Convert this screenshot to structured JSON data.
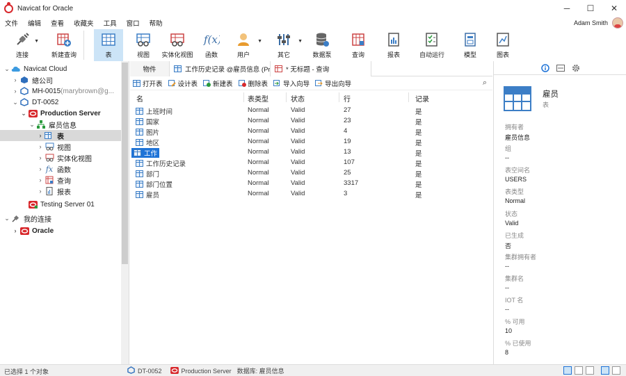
{
  "window": {
    "title": "Navicat for Oracle",
    "minimize": "─",
    "maximize": "☐",
    "close": "✕"
  },
  "menu": [
    "文件",
    "编辑",
    "查看",
    "收藏夹",
    "工具",
    "窗口",
    "帮助"
  ],
  "user": {
    "name": "Adam Smith"
  },
  "toolbar": [
    {
      "label": "连接",
      "icon": "connection-icon",
      "caret": true
    },
    {
      "label": "新建查询",
      "icon": "new-query-icon"
    },
    {
      "label": "表",
      "icon": "table-icon",
      "active": true
    },
    {
      "label": "视图",
      "icon": "view-icon"
    },
    {
      "label": "实体化视图",
      "icon": "materialized-view-icon"
    },
    {
      "label": "函数",
      "icon": "function-icon"
    },
    {
      "label": "用户",
      "icon": "user-icon",
      "caret": true
    },
    {
      "label": "其它",
      "icon": "tools-icon",
      "caret": true
    },
    {
      "label": "数据泵",
      "icon": "data-pump-icon"
    },
    {
      "label": "查询",
      "icon": "query-icon"
    },
    {
      "label": "报表",
      "icon": "report-icon"
    },
    {
      "label": "自动运行",
      "icon": "automation-icon"
    },
    {
      "label": "模型",
      "icon": "model-icon"
    },
    {
      "label": "图表",
      "icon": "chart-icon"
    }
  ],
  "tree": [
    {
      "label": "Navicat Cloud",
      "twisty": "⌄",
      "icon": "cloud-icon"
    },
    {
      "label": "總公司",
      "twisty": "›",
      "icon": "project-icon"
    },
    {
      "label": "MH-0015",
      "extra": " (marybrown@g...",
      "twisty": "›",
      "icon": "cloud-connection-icon"
    },
    {
      "label": "DT-0052",
      "twisty": "⌄",
      "icon": "cloud-connection-icon"
    },
    {
      "label": "Production Server",
      "twisty": "⌄",
      "icon": "oracle-server-icon",
      "bold": true
    },
    {
      "label": "雇员信息",
      "twisty": "⌄",
      "icon": "schema-icon"
    },
    {
      "label": "表",
      "twisty": "›",
      "icon": "table-icon",
      "bold": true,
      "selected": true
    },
    {
      "label": "视图",
      "twisty": "›",
      "icon": "view-icon"
    },
    {
      "label": "实体化视图",
      "twisty": "›",
      "icon": "materialized-view-icon"
    },
    {
      "label": "函数",
      "twisty": "›",
      "icon": "function-icon"
    },
    {
      "label": "查询",
      "twisty": "›",
      "icon": "query-icon"
    },
    {
      "label": "报表",
      "twisty": "›",
      "icon": "report-icon"
    },
    {
      "label": "Testing Server 01",
      "twisty": "",
      "icon": "oracle-server-icon"
    },
    {
      "label": "我的连接",
      "twisty": "⌄",
      "icon": "connection-icon"
    },
    {
      "label": "Oracle",
      "twisty": "›",
      "icon": "oracle-server-icon"
    }
  ],
  "tabs": {
    "objects": "物件",
    "tab1": "工作历史记录 @雇员信息 (Pr...",
    "tab2": "* 无标题 - 查询"
  },
  "objbar": [
    "打开表",
    "设计表",
    "新建表",
    "删除表",
    "导入向导",
    "导出向导"
  ],
  "columns": [
    "名",
    "表类型",
    "状态",
    "行",
    "记录"
  ],
  "rows": [
    {
      "name": "上班时间",
      "type": "Normal",
      "status": "Valid",
      "rows": "27",
      "record": "是"
    },
    {
      "name": "国家",
      "type": "Normal",
      "status": "Valid",
      "rows": "23",
      "record": "是"
    },
    {
      "name": "图片",
      "type": "Normal",
      "status": "Valid",
      "rows": "4",
      "record": "是"
    },
    {
      "name": "地区",
      "type": "Normal",
      "status": "Valid",
      "rows": "19",
      "record": "是"
    },
    {
      "name": "工作",
      "type": "Normal",
      "status": "Valid",
      "rows": "13",
      "record": "是",
      "selected": true
    },
    {
      "name": "工作历史记录",
      "type": "Normal",
      "status": "Valid",
      "rows": "107",
      "record": "是"
    },
    {
      "name": "部门",
      "type": "Normal",
      "status": "Valid",
      "rows": "25",
      "record": "是"
    },
    {
      "name": "部门位置",
      "type": "Normal",
      "status": "Valid",
      "rows": "3317",
      "record": "是"
    },
    {
      "name": "雇员",
      "type": "Normal",
      "status": "Valid",
      "rows": "3",
      "record": "是"
    }
  ],
  "detail": {
    "name": "雇员",
    "kind": "表",
    "props": [
      {
        "label": "拥有者",
        "value": "雇员信息"
      },
      {
        "label": "组",
        "value": "--"
      },
      {
        "label": "表空间名",
        "value": "USERS"
      },
      {
        "label": "表类型",
        "value": "Normal"
      },
      {
        "label": "状态",
        "value": "Valid"
      },
      {
        "label": "已生成",
        "value": "否"
      },
      {
        "label": "集群拥有者",
        "value": "--"
      },
      {
        "label": "集群名",
        "value": "--"
      },
      {
        "label": "IOT 名",
        "value": "--"
      },
      {
        "label": "% 可用",
        "value": "10"
      },
      {
        "label": "% 已使用",
        "value": "8"
      }
    ]
  },
  "status": {
    "selected": "已选择 1 个对象",
    "connection": "DT-0052",
    "server": "Production Server",
    "database": "数据库: 雇员信息"
  },
  "colors": {
    "accent": "#1e73d7",
    "oracle_red": "#d8282c",
    "icon_blue": "#3c7ec6"
  }
}
